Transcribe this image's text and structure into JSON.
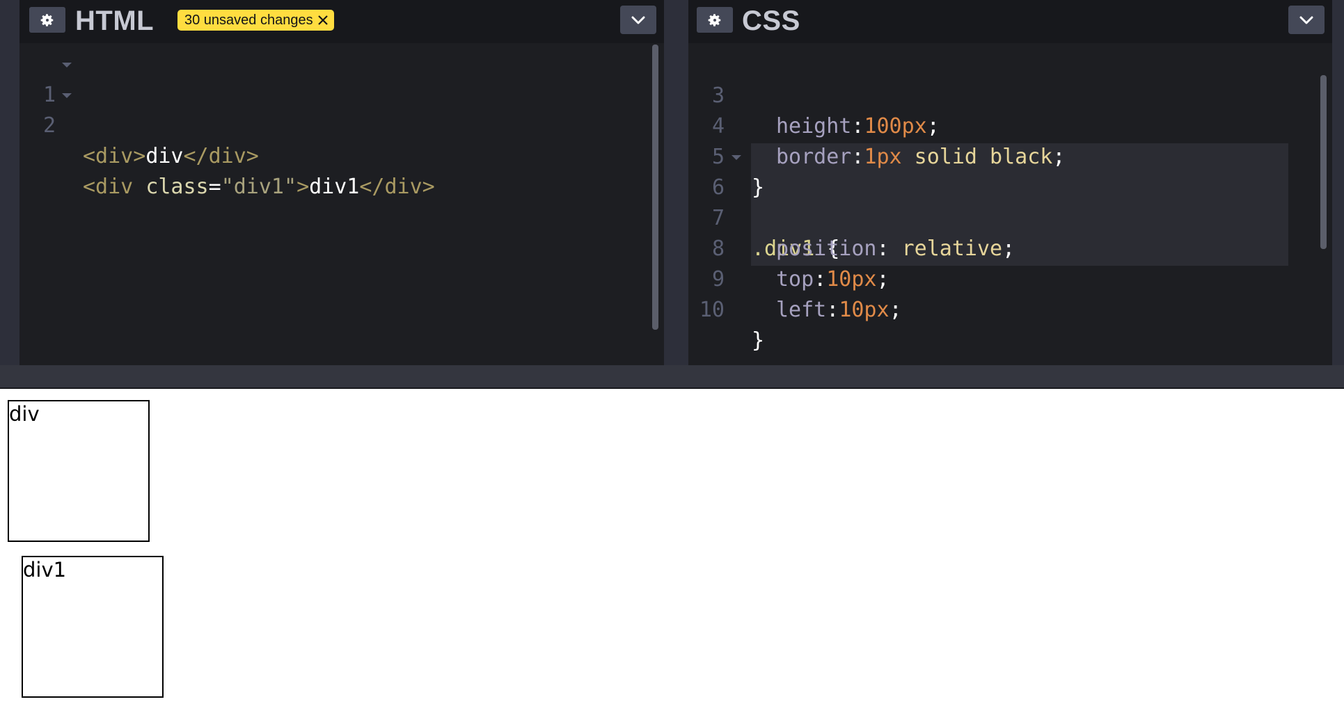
{
  "html_panel": {
    "title": "HTML",
    "unsaved_badge": "30 unsaved changes",
    "lines": [
      {
        "num": "1",
        "fold": true
      },
      {
        "num": "2",
        "fold": true
      }
    ],
    "code": {
      "l1": [
        "<div>",
        "div",
        "</div>"
      ],
      "l2": [
        "<div ",
        "class",
        "=",
        "\"div1\"",
        ">",
        "div1",
        "</div>"
      ]
    }
  },
  "css_panel": {
    "title": "CSS",
    "lines": [
      {
        "num": "3"
      },
      {
        "num": "4"
      },
      {
        "num": "5"
      },
      {
        "num": "6",
        "fold": true
      },
      {
        "num": "7"
      },
      {
        "num": "8"
      },
      {
        "num": "9"
      },
      {
        "num": "10"
      }
    ],
    "code": {
      "l3": [
        "height",
        ":",
        "100px",
        ";"
      ],
      "l4": [
        "border",
        ":",
        "1px",
        " solid black",
        ";"
      ],
      "l5": [
        "}"
      ],
      "l6": [
        ".div1",
        " {"
      ],
      "l7": [
        "position",
        ": ",
        "relative",
        ";"
      ],
      "l8": [
        "top",
        ":",
        "10px",
        ";"
      ],
      "l9": [
        "left",
        ":",
        "10px",
        ";"
      ],
      "l10": [
        "}"
      ]
    }
  },
  "preview": {
    "box1": "div",
    "box2": "div1"
  },
  "colors": {
    "badge": "#ffdd40",
    "editor_bg": "#1d1e22",
    "header_bg": "#17181c",
    "button_bg": "#444857"
  },
  "icons": [
    "gear-icon",
    "close-icon",
    "chevron-down-icon"
  ]
}
